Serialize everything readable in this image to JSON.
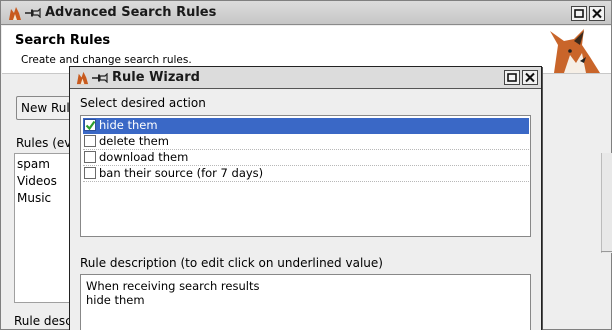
{
  "main_window": {
    "title": "Advanced Search Rules",
    "header_title": "Search Rules",
    "header_subtitle": "Create and change search rules.",
    "new_rule_label": "New Rule",
    "rules_label": "Rules (eva",
    "rules": [
      "spam",
      "Videos",
      "Music"
    ],
    "rule_description_label": "Rule desc"
  },
  "wizard": {
    "title": "Rule Wizard",
    "select_label": "Select desired action",
    "actions": [
      {
        "label": "hide them",
        "checked": true,
        "selected": true
      },
      {
        "label": "delete them",
        "checked": false,
        "selected": false
      },
      {
        "label": "download them",
        "checked": false,
        "selected": false
      },
      {
        "label": "ban their source (for 7 days)",
        "checked": false,
        "selected": false
      }
    ],
    "description_label": "Rule description (to edit click on underlined value)",
    "description_lines": [
      "When receiving search results",
      "hide them"
    ]
  },
  "colors": {
    "selection": "#3a68c6",
    "checkmark": "#2e9e2e"
  },
  "icons": {
    "app": "fox-app-icon",
    "pin": "pin-icon",
    "maximize": "maximize-icon",
    "close": "close-icon",
    "logo": "fox-logo"
  }
}
